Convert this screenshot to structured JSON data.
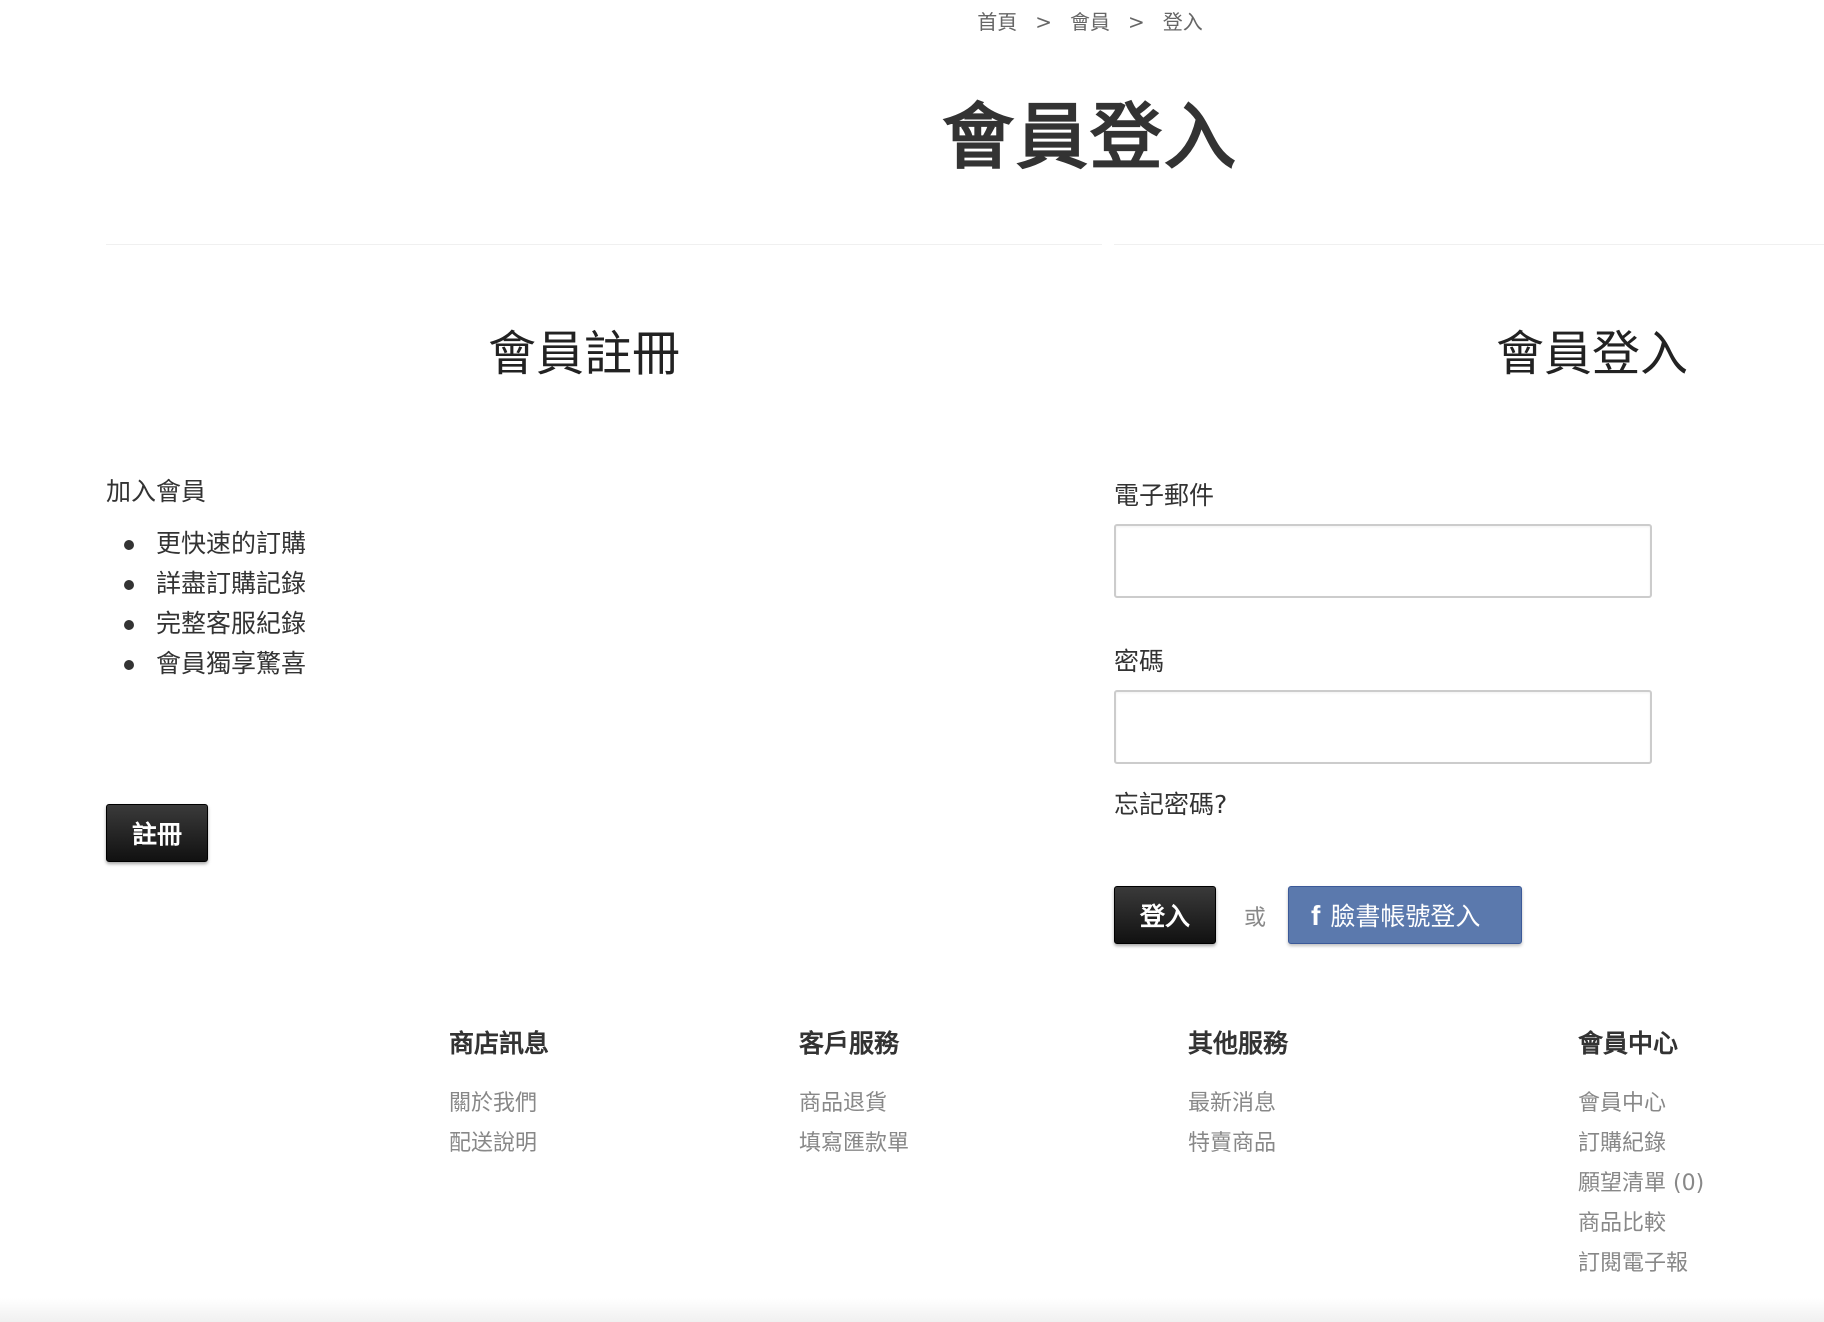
{
  "breadcrumb": {
    "items": [
      "首頁",
      "會員",
      "登入"
    ],
    "separator": ">"
  },
  "page_title": "會員登入",
  "register": {
    "title": "會員註冊",
    "join_title": "加入會員",
    "benefits": [
      "更快速的訂購",
      "詳盡訂購記錄",
      "完整客服紀錄",
      "會員獨享驚喜"
    ],
    "button": "註冊"
  },
  "login": {
    "title": "會員登入",
    "email_label": "電子郵件",
    "email_value": "",
    "password_label": "密碼",
    "password_value": "",
    "forgot": "忘記密碼?",
    "button": "登入",
    "or": "或",
    "fb_icon": "f",
    "fb_button": "臉書帳號登入"
  },
  "footer": {
    "columns": [
      {
        "heading": "商店訊息",
        "links": [
          "關於我們",
          "配送說明"
        ]
      },
      {
        "heading": "客戶服務",
        "links": [
          "商品退貨",
          "填寫匯款單"
        ]
      },
      {
        "heading": "其他服務",
        "links": [
          "最新消息",
          "特賣商品"
        ]
      },
      {
        "heading": "會員中心",
        "links": [
          "會員中心",
          "訂購紀錄",
          "願望清單 (0)",
          "商品比較",
          "訂閱電子報"
        ]
      }
    ]
  },
  "colors": {
    "facebook": "#5b79ad",
    "dark_button": "#1a1a1a",
    "link_gray": "#888888"
  }
}
